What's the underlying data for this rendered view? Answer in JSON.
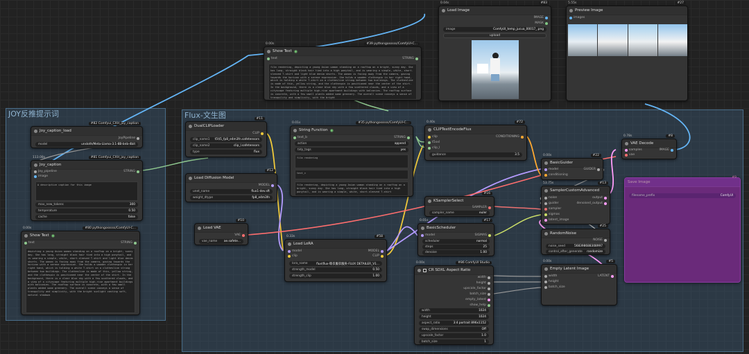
{
  "groups": {
    "joy": "JOY反推提示词",
    "flux": "Flux-文生图"
  },
  "nodes": {
    "load_image": {
      "time": "0.04s",
      "id": "#83",
      "title": "Load Image",
      "out1": "IMAGE",
      "out2": "MASK",
      "image_label": "image",
      "image_value": "ComfyUI_temp_jucua_00017_.png",
      "upload": "upload"
    },
    "preview": {
      "time": "5.55s",
      "id": "#27",
      "title": "Preview Image",
      "in": "images"
    },
    "show_top": {
      "time": "0.00s",
      "id": "#39 pythongosssss/ComfyUI-C...",
      "title": "Show Text",
      "in": "text",
      "out": "STRING",
      "text": "film rendering, depicting a young Asian woman standing on a rooftop on a bright, sunny day. She has long, straight black hair tied into a high ponytail, and is wearing a simple, white, short-sleeved T-shirt and light blue denim shorts. The woman is facing away from the camera, gazing towards the horizon with a serene expression. She holds a wooden clothespin in her right hand, which is holding a white T-shirt on a clothesline strung between two buildings. The clothesline is made of thin, yellow string, and the clothespin is positioned near the center of the shirt. In the background, there is a clear blue sky with a few scattered clouds, and a view of a cityscape featuring multiple high-rise apartment buildings with balconies. The rooftop surface is concrete, with a few small plants added some greenery. The overall scene conveys a sense of tranquility and simplicity, with the bright"
    },
    "joy_load": {
      "id": "#82 Comfyui_CXH_joy_caption",
      "title": "Joy_caption_load",
      "out": "JoyPipeline",
      "model_label": "model",
      "model_value": "unsloth/Meta-Llama-3.1-8B-bnb-4bit"
    },
    "joy_caption": {
      "time": "113.08s",
      "id": "#81 Comfyui_CXH_joy_caption",
      "title": "Joy_caption",
      "in1": "Joy_pipeline",
      "in2": "image",
      "out": "STRING",
      "prompt": "A descriptive caption for this image",
      "max_tokens_label": "max_new_tokens",
      "max_tokens": "300",
      "temp_label": "temperature",
      "temp": "0.50",
      "cache_label": "cache",
      "cache": "false"
    },
    "show_left": {
      "time": "0.00s",
      "id": "#80 pythongosssss/ComfyUI-C...",
      "title": "Show Text",
      "in": "text",
      "out": "STRING",
      "text": "depicting a young Asian woman standing on a rooftop on a bright, sunny day. She has long, straight black hair tied into a high ponytail, and is wearing a simple, white, short-sleeved T-shirt and light blue denim shorts. The woman is facing away from the camera, gazing towards the horizon with a serene expression. She holds a wooden clothespin in her right hand, which is holding a white T-shirt on a clothesline strung between two buildings. The clothesline is made of thin, yellow string, and the clothespin is positioned near the center of the shirt. In the background, there is a clear blue sky with a few scattered clouds, and a view of a cityscape featuring multiple high-rise apartment buildings with balconies. The rooftop surface is concrete, with a few small plants added some greenery. The overall scene conveys a sense of tranquility and simplicity, with the bright sunlight casting soft, natural shadows"
    },
    "dualclip": {
      "id": "#11",
      "title": "DualCLIPLoader",
      "out": "CLIP",
      "n1_label": "clip_name1",
      "n1": "t5\\t5_fp8_e4m3fn.safetensors",
      "n2_label": "clip_name2",
      "n2": "clip_l.safetensors",
      "type_label": "type",
      "type": "flux"
    },
    "diffusion": {
      "id": "#12",
      "title": "Load Diffusion Model",
      "out": "MODEL",
      "unet_label": "unet_name",
      "unet": "flux1-dev.sft",
      "dtype_label": "weight_dtype",
      "dtype": "fp8_e4m3fn"
    },
    "vae": {
      "id": "#10",
      "title": "Load VAE",
      "out": "VAE",
      "name_label": "vae_name",
      "name": "ae.safete..."
    },
    "string_fn": {
      "time": "0.01s",
      "id": "#35 pythongosssss/ComfyUI-C...",
      "title": "String Function",
      "in": "text_b",
      "out": "STRING",
      "action_label": "action",
      "action": "append",
      "tidy_label": "tidy_tags",
      "tidy": "yes",
      "text_a": "film rendering",
      "text_c": "text_c",
      "result": "film rendering, depicting a young Asian woman standing on a rooftop on a bright, sunny day. She has long, straight black hair tied into a high ponytail, and is wearing a simple, white, short-sleeved T-shirt"
    },
    "lora": {
      "time": "0.33s",
      "id": "#58",
      "title": "Load LoRA",
      "in1": "model",
      "in2": "clip",
      "out1": "MODEL",
      "out2": "CLIP",
      "name_label": "lora_name",
      "name": "flux\\flux-晾衣服衣服夹-FLUX DETAILER_V1...",
      "sm_label": "strength_model",
      "sm": "0.50",
      "sc_label": "strength_clip",
      "sc": "1.00"
    },
    "clipenc": {
      "time": "0.40s",
      "id": "#72",
      "title": "CLIPTextEncodeFlux",
      "in1": "clip",
      "in2": "t5xxl",
      "in3": "clip_l",
      "out": "CONDITIONING",
      "guidance_label": "guidance",
      "guidance": "3.5"
    },
    "ksampler_sel": {
      "id": "#16",
      "title": "KSamplerSelect",
      "out": "SAMPLER",
      "name_label": "sampler_name",
      "name": "euler"
    },
    "scheduler": {
      "time": "0.01s",
      "id": "#17",
      "title": "BasicScheduler",
      "in": "model",
      "out": "SIGMAS",
      "s_label": "scheduler",
      "s": "normal",
      "steps_label": "steps",
      "steps": "25",
      "denoise_label": "denoise",
      "denoise": "1.00"
    },
    "sdxl": {
      "time": "0.00s",
      "id": "#86 ComfyUI Studio",
      "title": "CR SDXL Aspect Ratio",
      "outs": [
        "width",
        "height",
        "upscale_factor",
        "batch_size",
        "empty_latent",
        "show_help"
      ],
      "w_label": "width",
      "w": "1024",
      "h_label": "height",
      "h": "1024",
      "ar_label": "aspect_ratio",
      "ar": "3:4 portrait 896x1152",
      "swap_label": "swap_dimensions",
      "swap": "Off",
      "up_label": "upscale_factor",
      "up": "1.0",
      "bs_label": "batch_size",
      "bs": "1"
    },
    "guider": {
      "time": "0.00s",
      "id": "#22",
      "title": "BasicGuider",
      "in1": "model",
      "in2": "conditioning",
      "out": "GUIDER"
    },
    "custom_adv": {
      "time": "53.75s",
      "id": "#13",
      "title": "SamplerCustomAdvanced",
      "ins": [
        "noise",
        "guider",
        "sampler",
        "sigmas",
        "latent_image"
      ],
      "out1": "output",
      "out2": "denoised_output"
    },
    "noise": {
      "id": "#25",
      "title": "RandomNoise",
      "out": "NOISE",
      "seed_label": "noise_seed",
      "seed": "568398688308997",
      "cag_label": "control_after_generate",
      "cag": "randomize"
    },
    "latent": {
      "time": "0.00s",
      "id": "#5",
      "title": "Empty Latent Image",
      "ins": [
        "width",
        "height",
        "batch_size"
      ],
      "out": "LATENT"
    },
    "vae_decode": {
      "time": "0.78s",
      "id": "#8",
      "title": "VAE Decode",
      "in1": "samples",
      "in2": "vae",
      "out": "IMAGE"
    },
    "purple": {
      "title": "Save Image",
      "id": "#9",
      "line1": "filename_prefix",
      "line2": "ComfyUI"
    }
  },
  "colors": {
    "clip": "#f0c93a",
    "model": "#b49bff",
    "vae": "#ff6e6e",
    "string": "#8fc88f",
    "image": "#64b5f6",
    "cond": "#ffa931",
    "latent": "#ff9cf9",
    "sigmas": "#cde068",
    "noise": "#cccccc",
    "sampler": "#ec7070"
  }
}
